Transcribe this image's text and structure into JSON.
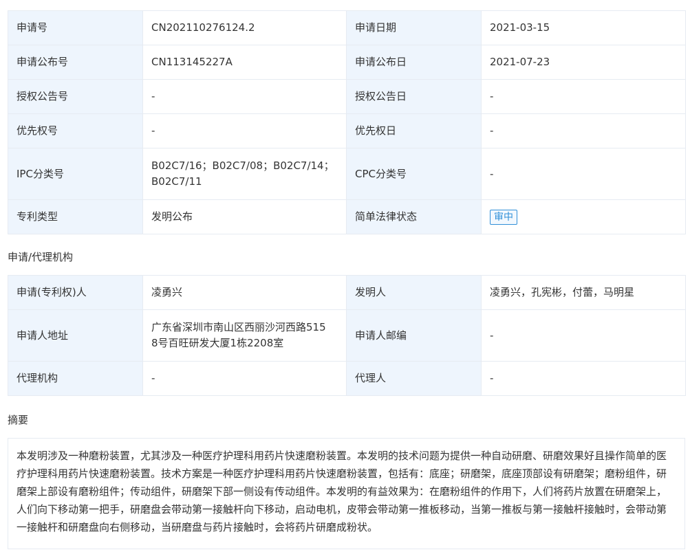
{
  "basic": {
    "rows": [
      {
        "label1": "申请号",
        "value1": "CN202110276124.2",
        "label2": "申请日期",
        "value2": "2021-03-15"
      },
      {
        "label1": "申请公布号",
        "value1": "CN113145227A",
        "label2": "申请公布日",
        "value2": "2021-07-23"
      },
      {
        "label1": "授权公告号",
        "value1": "-",
        "label2": "授权公告日",
        "value2": "-"
      },
      {
        "label1": "优先权号",
        "value1": "-",
        "label2": "优先权日",
        "value2": "-"
      },
      {
        "label1": "IPC分类号",
        "value1a": "B02C7/16；B02C7/08；B02C7/14；",
        "value1b": "B02C7/11",
        "label2": "CPC分类号",
        "value2": "-"
      },
      {
        "label1": "专利类型",
        "value1": "发明公布",
        "label2": "简单法律状态",
        "value2": "审中"
      }
    ]
  },
  "agency": {
    "title": "申请/代理机构",
    "rows": [
      {
        "label1": "申请(专利权)人",
        "value1": "凌勇兴",
        "label2": "发明人",
        "value2": "凌勇兴，孔宪彬，付蕾，马明星"
      },
      {
        "label1": "申请人地址",
        "value1a": "广东省深圳市南山区西丽沙河西路515",
        "value1b": "8号百旺研发大厦1栋2208室",
        "label2": "申请人邮编",
        "value2": "-"
      },
      {
        "label1": "代理机构",
        "value1": "-",
        "label2": "代理人",
        "value2": "-"
      }
    ]
  },
  "abstract": {
    "title": "摘要",
    "text": "本发明涉及一种磨粉装置，尤其涉及一种医疗护理科用药片快速磨粉装置。本发明的技术问题为提供一种自动研磨、研磨效果好且操作简单的医疗护理科用药片快速磨粉装置。技术方案是一种医疗护理科用药片快速磨粉装置，包括有：底座；研磨架，底座顶部设有研磨架；磨粉组件，研磨架上部设有磨粉组件；传动组件，研磨架下部一侧设有传动组件。本发明的有益效果为：在磨粉组件的作用下，人们将药片放置在研磨架上，人们向下移动第一把手，研磨盘会带动第一接触杆向下移动，启动电机，皮带会带动第一推板移动，当第一推板与第一接触杆接触时，会带动第一接触杆和研磨盘向右侧移动，当研磨盘与药片接触时，会将药片研磨成粉状。"
  },
  "colors": {
    "label_bg": "#eef5fd",
    "border": "#e6ebf2",
    "badge": "#2f8fd8"
  }
}
